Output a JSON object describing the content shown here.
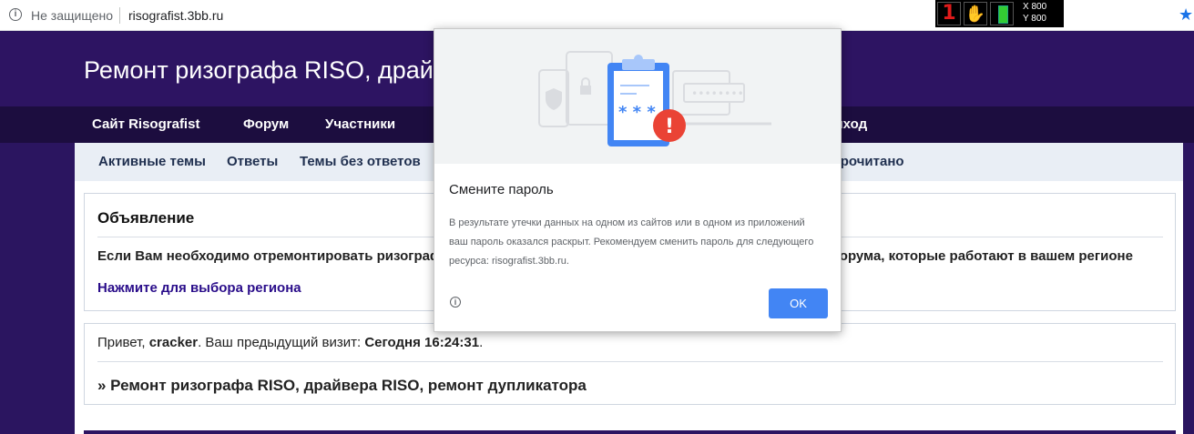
{
  "browser": {
    "security_text": "Не защищено",
    "url": "risografist.3bb.ru",
    "info_icon": "info-icon",
    "bookmark_icon": "star-icon"
  },
  "overlay": {
    "num": "1",
    "x_label": "X 800",
    "y_label": "Y 800"
  },
  "site": {
    "title": "Ремонт ризографа RISO, драйвера RISO, ремонт дупликатора",
    "nav": [
      "Сайт Risografist",
      "Форум",
      "Участники",
      "Выход"
    ],
    "subnav": [
      "Активные темы",
      "Ответы",
      "Темы без ответов",
      "Всё прочитано"
    ]
  },
  "announcement": {
    "title": "Объявление",
    "text": "Если Вам необходимо отремонтировать ризограф или дупликатор, обращайтесь к опытным сервисантам форума, которые работают в вашем регионе",
    "link": "Нажмите для выбора региона"
  },
  "welcome": {
    "greeting_prefix": "Привет,",
    "username": "cracker",
    "visit_label": ".  Ваш предыдущий визит:",
    "visit_time": "Сегодня 16:24:31",
    "end": ".",
    "forum_link": "» Ремонт ризографа RISO, драйвера RISO, ремонт дупликатора"
  },
  "dialog": {
    "title": "Смените пароль",
    "body": "В результате утечки данных на одном из сайтов или в одном из приложений ваш пароль оказался раскрыт. Рекомендуем сменить пароль для следующего ресурса: risografist.3bb.ru.",
    "ok_label": "OK",
    "password_mask": "* * *",
    "alert_mark": "!"
  },
  "colors": {
    "header_bg": "#2d1462",
    "nav_bg": "#1c0d3f",
    "link": "#2a0d8a",
    "ok_button": "#4285f4",
    "alert_red": "#ea4335",
    "clipboard_blue": "#4285f4"
  }
}
